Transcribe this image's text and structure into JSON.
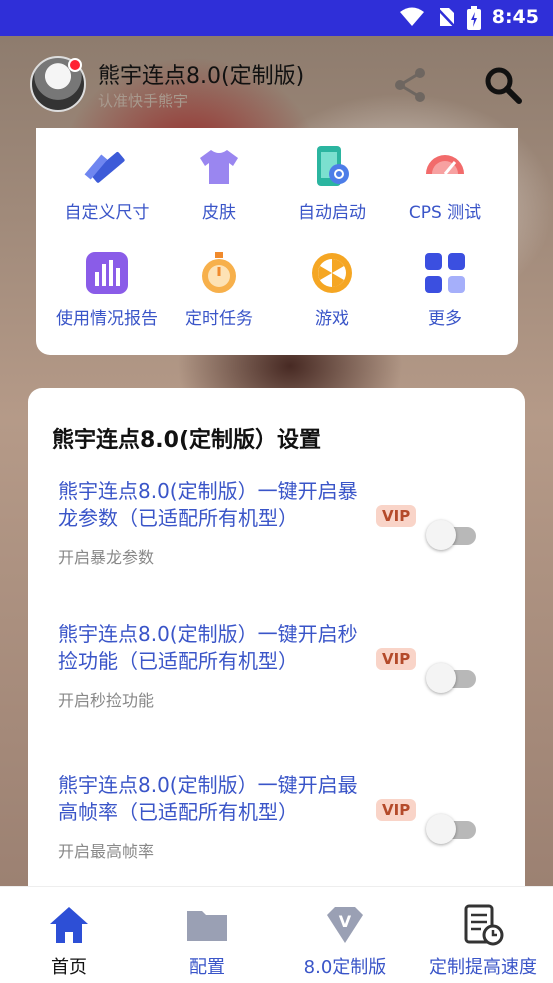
{
  "status_bar": {
    "time": "8:45"
  },
  "app_bar": {
    "title": "熊宇连点8.0(定制版)",
    "subtitle": "认准快手熊宇"
  },
  "grid": {
    "items": [
      {
        "label": "自定义尺寸",
        "icon": "ruler-pencil-icon"
      },
      {
        "label": "皮肤",
        "icon": "tshirt-icon"
      },
      {
        "label": "自动启动",
        "icon": "phone-link-icon"
      },
      {
        "label": "CPS 测试",
        "icon": "speedometer-icon"
      },
      {
        "label": "使用情况报告",
        "icon": "bar-chart-icon"
      },
      {
        "label": "定时任务",
        "icon": "stopwatch-icon"
      },
      {
        "label": "游戏",
        "icon": "wheel-icon"
      },
      {
        "label": "更多",
        "icon": "apps-grid-icon"
      }
    ]
  },
  "settings": {
    "title": "熊宇连点8.0(定制版）设置",
    "vip_label": "VIP",
    "items": [
      {
        "title": "熊宇连点8.0(定制版）一键开启暴龙参数（已适配所有机型）",
        "description": "开启暴龙参数",
        "enabled": false
      },
      {
        "title": "熊宇连点8.0(定制版）一键开启秒捡功能（已适配所有机型）",
        "description": "开启秒捡功能",
        "enabled": false
      },
      {
        "title": "熊宇连点8.0(定制版）一键开启最高帧率（已适配所有机型）",
        "description": "开启最高帧率",
        "enabled": false
      }
    ]
  },
  "bottom_nav": {
    "items": [
      {
        "label": "首页",
        "icon": "home-icon",
        "active": true
      },
      {
        "label": "配置",
        "icon": "folder-icon",
        "active": false
      },
      {
        "label": "8.0定制版",
        "icon": "v-diamond-icon",
        "active": false
      },
      {
        "label": "定制提高速度",
        "icon": "document-clock-icon",
        "active": false
      }
    ]
  },
  "colors": {
    "accent": "#3a55c8",
    "status_bar": "#2f2fd8",
    "vip_bg": "#f9d4c8"
  }
}
